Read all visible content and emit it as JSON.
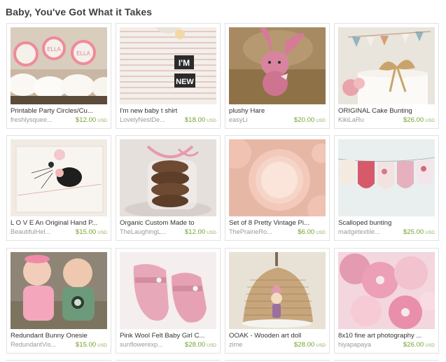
{
  "page": {
    "title": "Baby, You've Got What it Takes"
  },
  "colors": {
    "price": "#77a12e",
    "shop": "#9a9a9a",
    "border": "#e2e2e2"
  },
  "items": [
    {
      "title": "Printable Party Circles/Cu...",
      "shop": "freshlysquee...",
      "price": "$12.00",
      "currency": "USD"
    },
    {
      "title": "I'm new baby t shirt",
      "shop": "LovelyNestDe...",
      "price": "$18.00",
      "currency": "USD"
    },
    {
      "title": "plushy Hare",
      "shop": "easyLi",
      "price": "$20.00",
      "currency": "USD"
    },
    {
      "title": "ORIGINAL Cake Bunting",
      "shop": "KikiLaRu",
      "price": "$26.00",
      "currency": "USD"
    },
    {
      "title": "L O V E An Original Hand P...",
      "shop": "BeautifulHel...",
      "price": "$15.00",
      "currency": "USD"
    },
    {
      "title": "Organic Custom Made to",
      "shop": "TheLaughingL...",
      "price": "$12.00",
      "currency": "USD"
    },
    {
      "title": "Set of 8 Pretty Vintage Pi...",
      "shop": "ThePrairieRo...",
      "price": "$6.00",
      "currency": "USD"
    },
    {
      "title": "Scalloped bunting",
      "shop": "madgetextile...",
      "price": "$25.00",
      "currency": "USD"
    },
    {
      "title": "Redundant Bunny Onesie",
      "shop": "RedundantVis...",
      "price": "$15.00",
      "currency": "USD"
    },
    {
      "title": "Pink Wool Felt Baby Girl C...",
      "shop": "sunflowerexp...",
      "price": "$28.00",
      "currency": "USD"
    },
    {
      "title": "OOAK - Wooden art doll",
      "shop": "zime",
      "price": "$28.00",
      "currency": "USD"
    },
    {
      "title": "8x10 fine art photography ...",
      "shop": "hiyapapaya",
      "price": "$26.00",
      "currency": "USD"
    }
  ],
  "images": {
    "cupcakes_circle_1": "ELLA",
    "cupcakes_circle_2": "ELLA",
    "shirt_text_1": "I'M",
    "shirt_text_2": "NEW"
  }
}
